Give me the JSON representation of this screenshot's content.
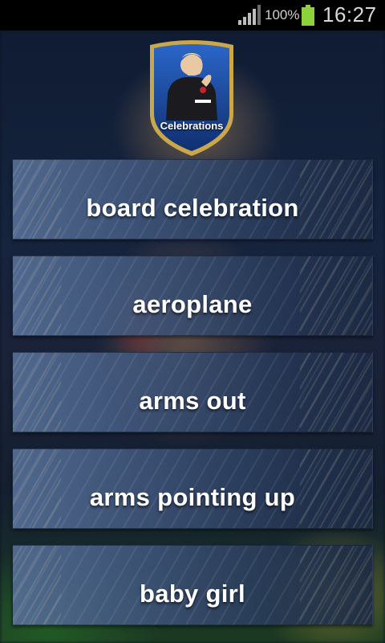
{
  "status_bar": {
    "battery_percent": "100%",
    "time": "16:27",
    "icons": [
      "signal-icon",
      "battery-icon"
    ]
  },
  "logo": {
    "text": "Celebrations",
    "colors": {
      "border": "#c9a74a",
      "shield": "#1a4aa0"
    }
  },
  "menu": {
    "items": [
      {
        "label": "board celebration"
      },
      {
        "label": "aeroplane"
      },
      {
        "label": "arms out"
      },
      {
        "label": "arms pointing up"
      },
      {
        "label": "baby girl"
      }
    ]
  }
}
